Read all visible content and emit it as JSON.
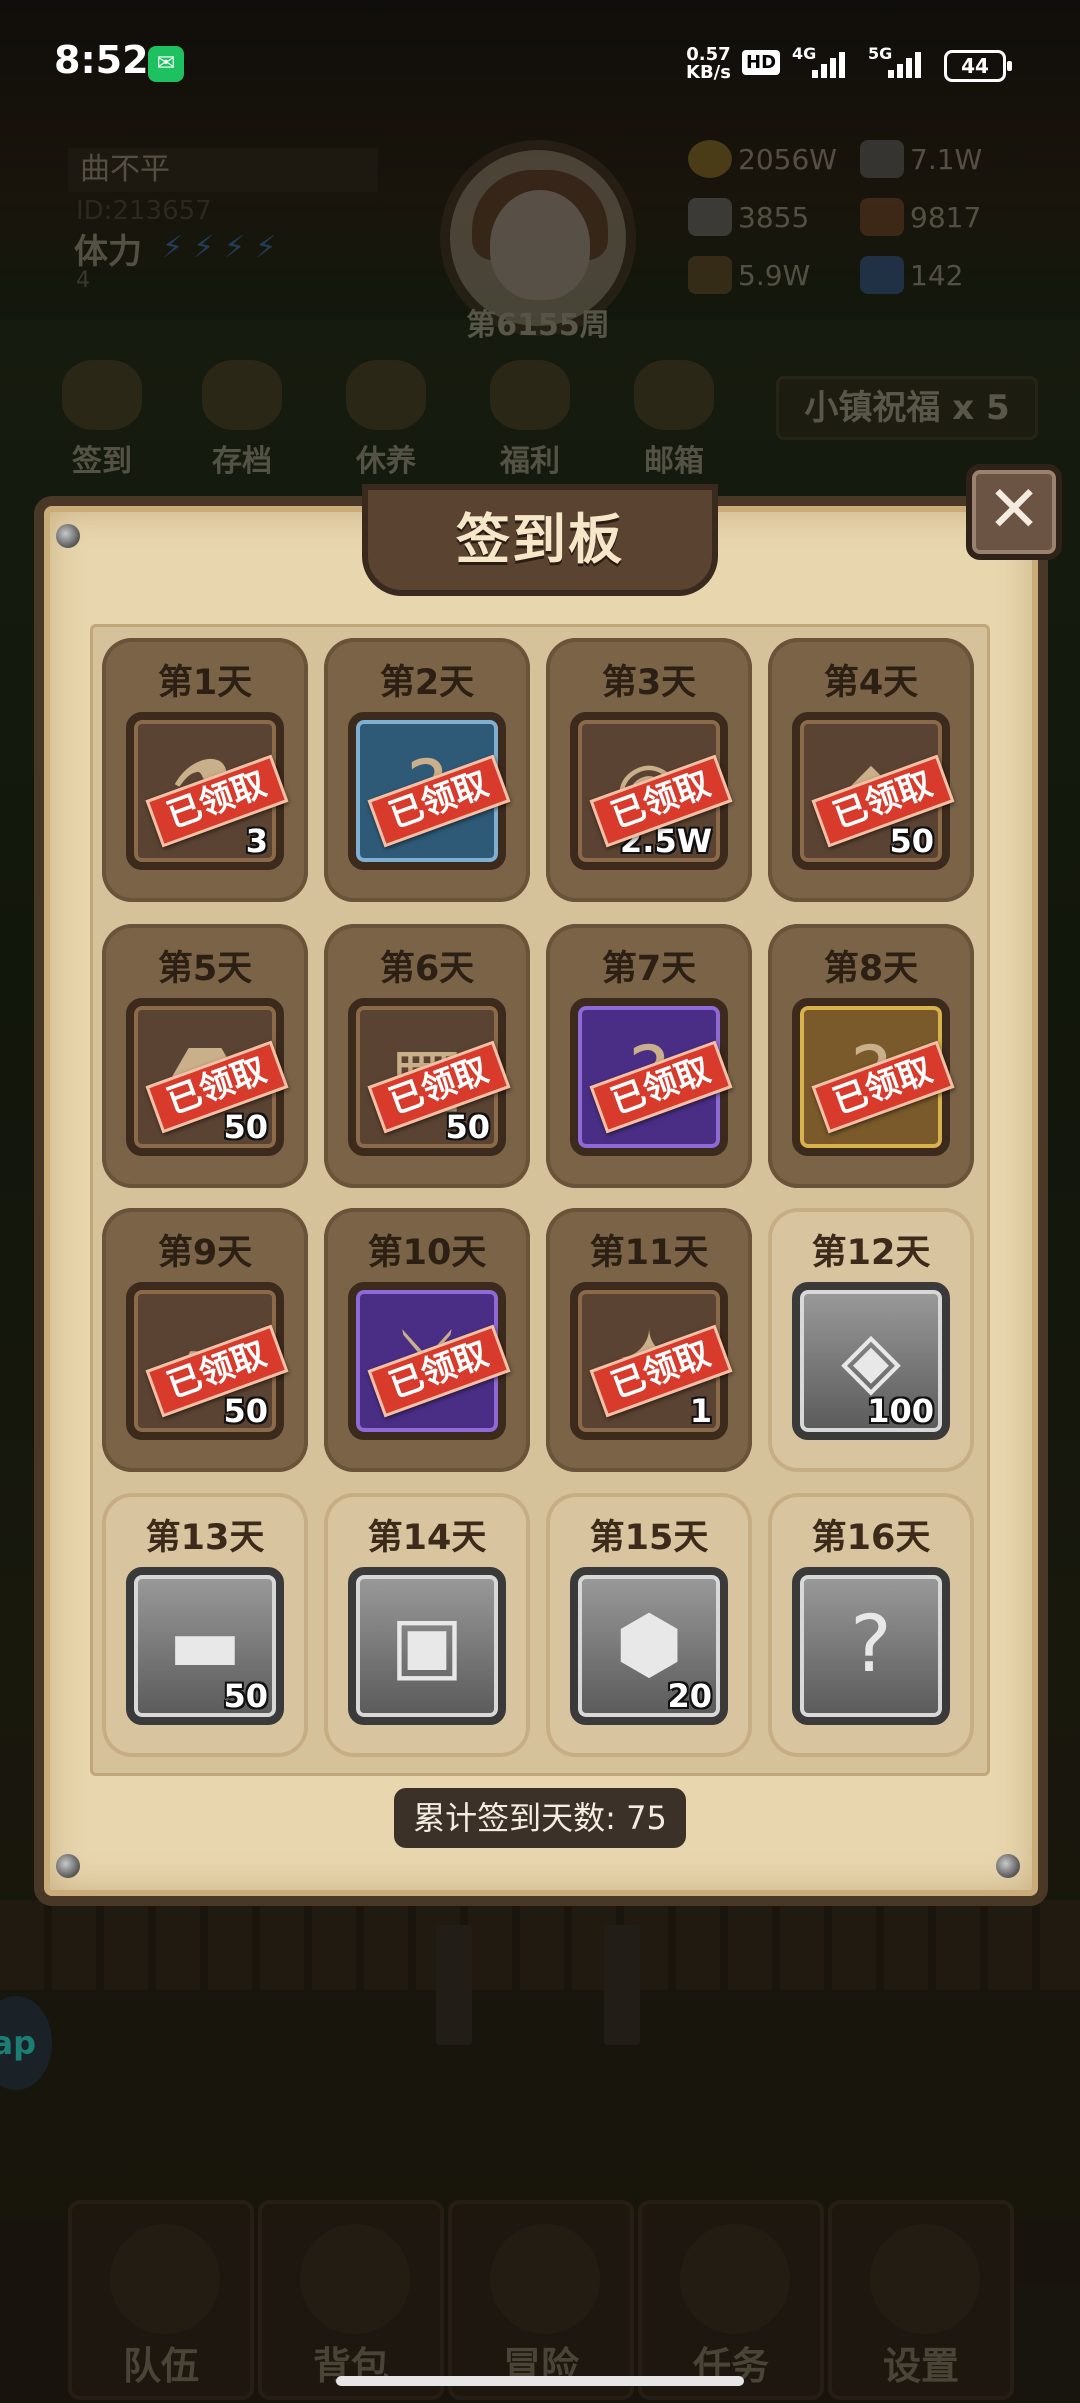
{
  "status_bar": {
    "time": "8:52",
    "net_speed_value": "0.57",
    "net_speed_unit": "KB/s",
    "hd": "HD",
    "network1": "4G",
    "network2": "5G",
    "battery": "44",
    "wechat_icon": "wechat-icon"
  },
  "player": {
    "name": "曲不平",
    "id": "ID:213657",
    "stamina_label": "体力",
    "stamina_value": "4",
    "week": "第6155周"
  },
  "resources": [
    {
      "icon": "gold-coin-icon",
      "value": "2056W",
      "color": "#c9a23a"
    },
    {
      "icon": "iron-ingot-icon",
      "value": "7.1W",
      "color": "#8a8a8a"
    },
    {
      "icon": "stone-icon",
      "value": "3855",
      "color": "#9b9b9b"
    },
    {
      "icon": "leather-icon",
      "value": "9817",
      "color": "#a0623a"
    },
    {
      "icon": "wood-log-icon",
      "value": "5.9W",
      "color": "#8b6a3a"
    },
    {
      "icon": "crystal-icon",
      "value": "142",
      "color": "#4a7ac8"
    }
  ],
  "quick_menu": [
    {
      "label": "签到",
      "icon": "signin-icon"
    },
    {
      "label": "存档",
      "icon": "save-scroll-icon"
    },
    {
      "label": "休养",
      "icon": "rest-icon"
    },
    {
      "label": "福利",
      "icon": "welfare-wheel-icon"
    },
    {
      "label": "邮箱",
      "icon": "mailbox-icon"
    }
  ],
  "blessing": "小镇祝福 x 5",
  "board": {
    "title": "签到板",
    "claimed_text": "已领取",
    "days": [
      {
        "day": "第1天",
        "qty": "3",
        "claimed": true,
        "icon": "potion-flask-icon",
        "glyph": "⚗",
        "bg": ""
      },
      {
        "day": "第2天",
        "qty": "",
        "claimed": true,
        "icon": "mystery-key-icon",
        "glyph": "?",
        "bg": "bg-blue"
      },
      {
        "day": "第3天",
        "qty": "2.5W",
        "claimed": true,
        "icon": "gold-pile-icon",
        "glyph": "◉",
        "bg": ""
      },
      {
        "day": "第4天",
        "qty": "50",
        "claimed": true,
        "icon": "blue-crystal-icon",
        "glyph": "◆",
        "bg": ""
      },
      {
        "day": "第5天",
        "qty": "50",
        "claimed": true,
        "icon": "ore-stone-icon",
        "glyph": "⬣",
        "bg": ""
      },
      {
        "day": "第6天",
        "qty": "50",
        "claimed": true,
        "icon": "leather-hide-icon",
        "glyph": "▦",
        "bg": ""
      },
      {
        "day": "第7天",
        "qty": "",
        "claimed": true,
        "icon": "mystery-key-icon",
        "glyph": "?",
        "bg": "bg-purple"
      },
      {
        "day": "第8天",
        "qty": "",
        "claimed": true,
        "icon": "mystery-key-icon",
        "glyph": "?",
        "bg": "bg-gold"
      },
      {
        "day": "第9天",
        "qty": "50",
        "claimed": true,
        "icon": "iron-ingot-icon",
        "glyph": "▰",
        "bg": ""
      },
      {
        "day": "第10天",
        "qty": "",
        "claimed": true,
        "icon": "sword-icon",
        "glyph": "⚔",
        "bg": "bg-purple"
      },
      {
        "day": "第11天",
        "qty": "1",
        "claimed": true,
        "icon": "sparkle-key-icon",
        "glyph": "✦",
        "bg": ""
      },
      {
        "day": "第12天",
        "qty": "100",
        "claimed": false,
        "icon": "silver-ore-icon",
        "glyph": "◈",
        "bg": ""
      },
      {
        "day": "第13天",
        "qty": "50",
        "claimed": false,
        "icon": "wood-log-icon",
        "glyph": "▬",
        "bg": ""
      },
      {
        "day": "第14天",
        "qty": "",
        "claimed": false,
        "icon": "backpack-icon",
        "glyph": "▣",
        "bg": ""
      },
      {
        "day": "第15天",
        "qty": "20",
        "claimed": false,
        "icon": "rune-stone-icon",
        "glyph": "⬢",
        "bg": ""
      },
      {
        "day": "第16天",
        "qty": "",
        "claimed": false,
        "icon": "question-mark-icon",
        "glyph": "?",
        "bg": ""
      }
    ],
    "total_label": "累计签到天数: 75"
  },
  "bottom_nav": [
    {
      "label": "队伍",
      "icon": "helmet-icon"
    },
    {
      "label": "背包",
      "icon": "backpack-icon"
    },
    {
      "label": "冒险",
      "icon": "crossed-swords-icon"
    },
    {
      "label": "任务",
      "icon": "quest-scroll-icon"
    },
    {
      "label": "设置",
      "icon": "gear-icon"
    }
  ],
  "tap_bubble": "ap"
}
